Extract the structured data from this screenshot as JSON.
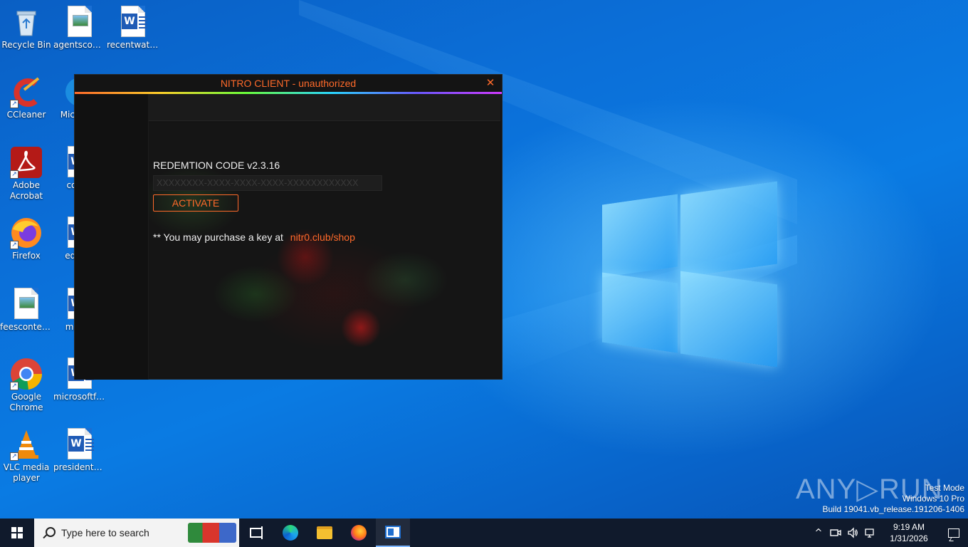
{
  "desktop": {
    "icons": [
      {
        "label": "Recycle Bin"
      },
      {
        "label": "agentscom..."
      },
      {
        "label": "recentwatc..."
      },
      {
        "label": "CCleaner"
      },
      {
        "label": "Mic... E..."
      },
      {
        "label": "Adobe Acrobat"
      },
      {
        "label": "com..."
      },
      {
        "label": "Firefox"
      },
      {
        "label": "edito..."
      },
      {
        "label": "feescontent..."
      },
      {
        "label": "maili..."
      },
      {
        "label": "Google Chrome"
      },
      {
        "label": "microsoftfe..."
      },
      {
        "label": "VLC media player"
      },
      {
        "label": "presidentba..."
      }
    ]
  },
  "nitro_window": {
    "title": "NITRO CLIENT - unauthorized",
    "close_glyph": "✕",
    "redeem_label": "REDEMTION CODE v2.3.16",
    "code_placeholder": "XXXXXXXX-XXXX-XXXX-XXXX-XXXXXXXXXXXX",
    "code_value": "",
    "activate_label": "ACTIVATE",
    "purchase_text": "** You may purchase a key at",
    "purchase_link": "nitr0.club/shop",
    "accent_color": "#ff6a2a"
  },
  "watermark": {
    "brand": "ANY▷RUN",
    "line1": "Test Mode",
    "line2": "Windows 10 Pro",
    "line3": "Build 19041.vb_release.191206-1406"
  },
  "taskbar": {
    "search_placeholder": "Type here to search",
    "pinned": [
      "task-view",
      "edge",
      "file-explorer",
      "firefox",
      "nitro-app"
    ],
    "tray": {
      "chevron": "^",
      "time": "9:19 AM",
      "date": "1/31/2026"
    }
  }
}
